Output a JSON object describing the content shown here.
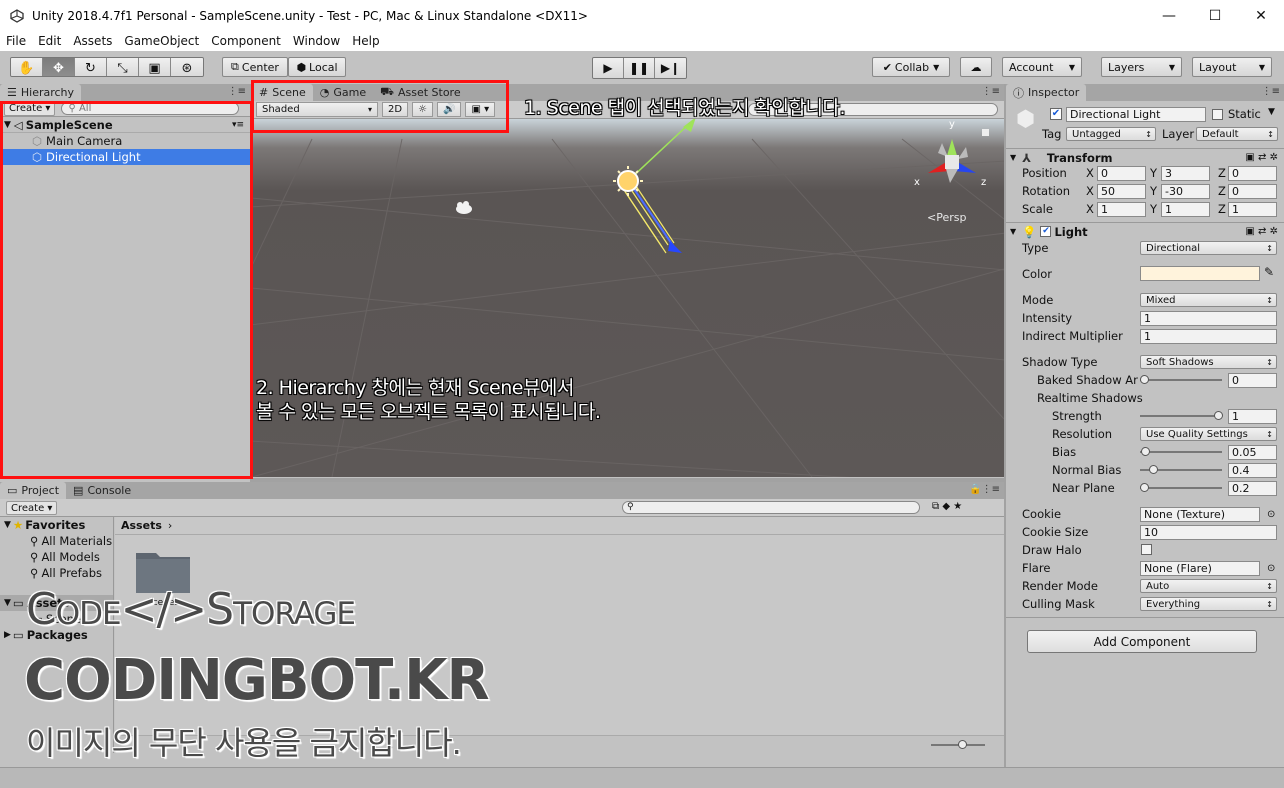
{
  "window": {
    "title": "Unity 2018.4.7f1 Personal - SampleScene.unity - Test - PC, Mac & Linux Standalone <DX11>",
    "buttons": [
      "—",
      "☐",
      "✕"
    ]
  },
  "menu": [
    "File",
    "Edit",
    "Assets",
    "GameObject",
    "Component",
    "Window",
    "Help"
  ],
  "toolbar": {
    "center": "Center",
    "local": "Local",
    "collab": "Collab",
    "account": "Account",
    "layers": "Layers",
    "layout": "Layout"
  },
  "hierarchy": {
    "tab": "Hierarchy",
    "create": "Create",
    "search_placeholder": "All",
    "scene": "SampleScene",
    "items": [
      "Main Camera",
      "Directional Light"
    ]
  },
  "scene_view": {
    "tabs": [
      "Scene",
      "Game",
      "Asset Store"
    ],
    "shading": "Shaded",
    "mode_2d": "2D",
    "persp": "Persp",
    "gizmo": {
      "x": "x",
      "y": "y",
      "z": "z"
    }
  },
  "inspector": {
    "tab": "Inspector",
    "object_name": "Directional Light",
    "static_label": "Static",
    "tag_label": "Tag",
    "tag_value": "Untagged",
    "layer_label": "Layer",
    "layer_value": "Default",
    "transform": {
      "title": "Transform",
      "position_label": "Position",
      "rotation_label": "Rotation",
      "scale_label": "Scale",
      "position": [
        "0",
        "3",
        "0"
      ],
      "rotation": [
        "50",
        "-30",
        "0"
      ],
      "scale": [
        "1",
        "1",
        "1"
      ],
      "axes": [
        "X",
        "Y",
        "Z"
      ]
    },
    "light": {
      "title": "Light",
      "type_label": "Type",
      "type_value": "Directional",
      "color_label": "Color",
      "color_value": "#fff3dc",
      "mode_label": "Mode",
      "mode_value": "Mixed",
      "intensity_label": "Intensity",
      "intensity_value": "1",
      "indirect_label": "Indirect Multiplier",
      "indirect_value": "1",
      "shadow_type_label": "Shadow Type",
      "shadow_type_value": "Soft Shadows",
      "baked_angle_label": "Baked Shadow Ar",
      "baked_angle_value": "0",
      "realtime_label": "Realtime Shadows",
      "strength_label": "Strength",
      "strength_value": "1",
      "resolution_label": "Resolution",
      "resolution_value": "Use Quality Settings",
      "bias_label": "Bias",
      "bias_value": "0.05",
      "normal_bias_label": "Normal Bias",
      "normal_bias_value": "0.4",
      "near_plane_label": "Near Plane",
      "near_plane_value": "0.2",
      "cookie_label": "Cookie",
      "cookie_value": "None (Texture)",
      "cookie_size_label": "Cookie Size",
      "cookie_size_value": "10",
      "draw_halo_label": "Draw Halo",
      "flare_label": "Flare",
      "flare_value": "None (Flare)",
      "render_mode_label": "Render Mode",
      "render_mode_value": "Auto",
      "culling_label": "Culling Mask",
      "culling_value": "Everything"
    },
    "add_component": "Add Component"
  },
  "project": {
    "tabs": [
      "Project",
      "Console"
    ],
    "create": "Create",
    "favorites": "Favorites",
    "favorite_items": [
      "All Materials",
      "All Models",
      "All Prefabs"
    ],
    "assets": "Assets",
    "asset_children": [
      "Scenes"
    ],
    "packages": "Packages",
    "breadcrumb": "Assets",
    "folder_name": "Scenes"
  },
  "annotations": {
    "note1": "1. Scene 탭이 선택되었는지 확인합니다.",
    "note2_line1": "2. Hierarchy 창에는 현재 Scene뷰에서",
    "note2_line2": "볼 수 있는  모든 오브젝트 목록이 표시됩니다."
  },
  "watermark": {
    "line1": "Code</>Storage",
    "line2": "CODINGBOT.KR",
    "line3": "이미지의 무단 사용을 금지합니다."
  },
  "colors": {
    "selection": "#3e7ce5",
    "highlight": "#ff1010",
    "panel": "#c2c2c2",
    "scene_bg": "#5a5554"
  }
}
